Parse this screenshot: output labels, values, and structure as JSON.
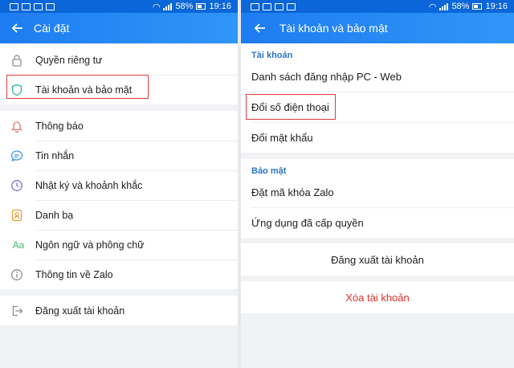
{
  "status_bar": {
    "battery": "58%",
    "time": "19:16"
  },
  "left": {
    "title": "Cài đặt",
    "group1": [
      {
        "label": "Quyền riêng tư",
        "icon": "lock-icon"
      },
      {
        "label": "Tài khoản và bảo mật",
        "icon": "shield-icon",
        "highlighted": true
      }
    ],
    "group2": [
      {
        "label": "Thông báo",
        "icon": "bell-icon"
      },
      {
        "label": "Tin nhắn",
        "icon": "chat-icon"
      },
      {
        "label": "Nhật ký và khoảnh khắc",
        "icon": "clock-icon"
      },
      {
        "label": "Danh bạ",
        "icon": "contacts-icon"
      },
      {
        "label": "Ngôn ngữ và phông chữ",
        "icon": "font-icon"
      },
      {
        "label": "Thông tin về Zalo",
        "icon": "info-icon"
      }
    ],
    "group3": [
      {
        "label": "Đăng xuất tài khoản",
        "icon": "logout-icon"
      }
    ],
    "font_icon_text": "Aa"
  },
  "right": {
    "title": "Tài khoản và bảo mật",
    "section_account": "Tài khoản",
    "account_items": [
      "Danh sách đăng nhập PC - Web",
      "Đổi số điện thoại",
      "Đổi mật khẩu"
    ],
    "section_security": "Bảo mật",
    "security_items": [
      "Đặt mã khóa Zalo",
      "Ứng dụng đã cấp quyền"
    ],
    "logout": "Đăng xuất tài khoản",
    "delete_account": "Xóa tài khoản"
  },
  "colors": {
    "header": "#1e7cf2",
    "section": "#2a74c9",
    "danger": "#e0322e",
    "highlight": "#e23a3a"
  }
}
